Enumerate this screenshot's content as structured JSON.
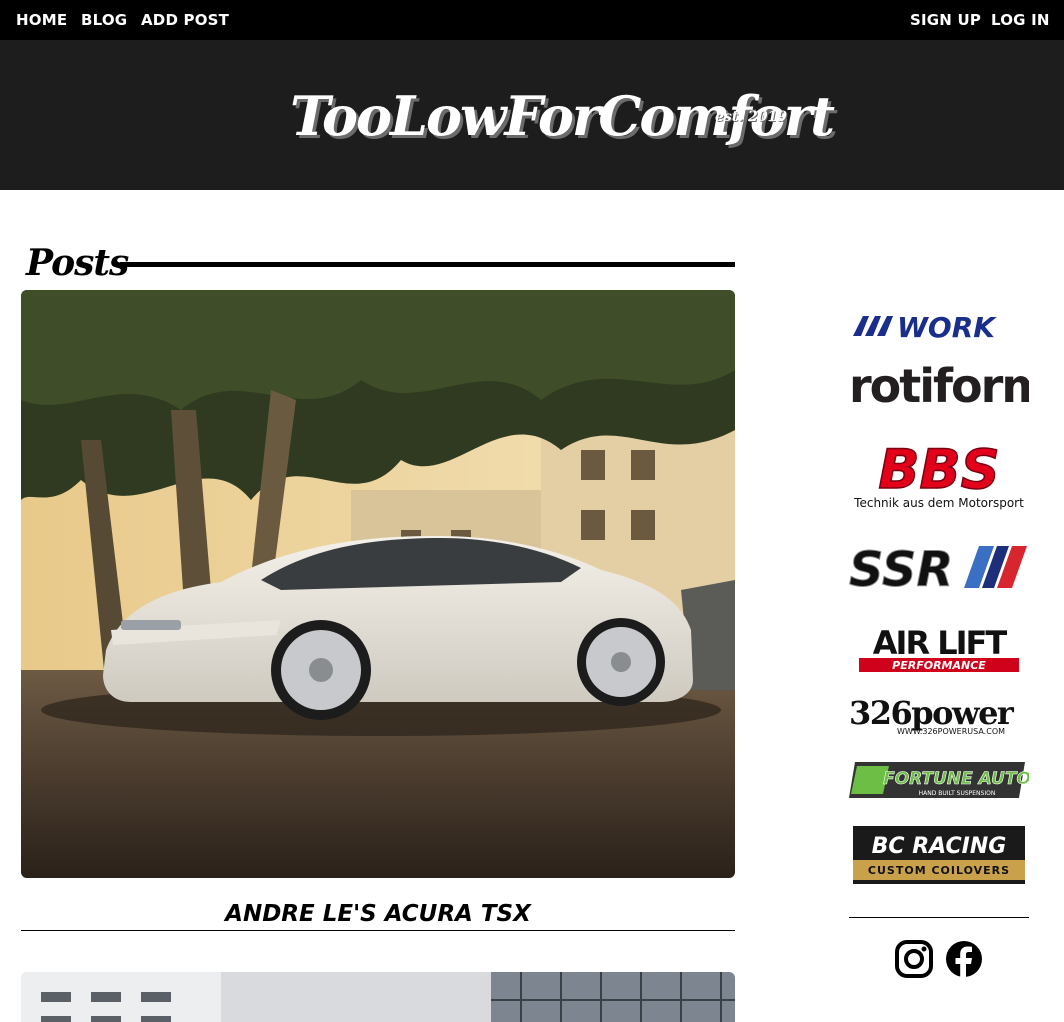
{
  "nav": {
    "home": "HOME",
    "blog": "BLOG",
    "add_post": "ADD POST",
    "sign_up": "SIGN UP",
    "log_in": "LOG IN"
  },
  "brand": {
    "name": "TooLowForComfort",
    "est": "est. 2019"
  },
  "posts": {
    "heading": "Posts",
    "items": [
      {
        "title": "ANDRE LE'S ACURA TSX"
      }
    ]
  },
  "sidebar": {
    "logos": [
      {
        "text": "WORK",
        "color": "#1a2e8c"
      },
      {
        "text": "rotiform",
        "color": "#231f20"
      },
      {
        "text": "BBS",
        "sub": "Technik aus dem Motorsport",
        "color": "#e2001a"
      },
      {
        "text": "SSR",
        "color": "#111111"
      },
      {
        "text": "AIR LIFT",
        "sub": "PERFORMANCE",
        "color": "#d0021b"
      },
      {
        "text": "326power",
        "sub": "WWW.326POWERUSA.COM",
        "color": "#111111"
      },
      {
        "text": "FORTUNE AUTO",
        "sub": "HAND BUILT SUSPENSION",
        "color": "#6cbe45"
      },
      {
        "text": "BC RACING",
        "sub": "CUSTOM COILOVERS",
        "color": "#c8a14a"
      }
    ],
    "social": [
      "instagram-icon",
      "facebook-icon"
    ]
  },
  "colors": {
    "nav_bg": "#000000",
    "banner_bg": "#1d1d1d",
    "text": "#000000"
  }
}
